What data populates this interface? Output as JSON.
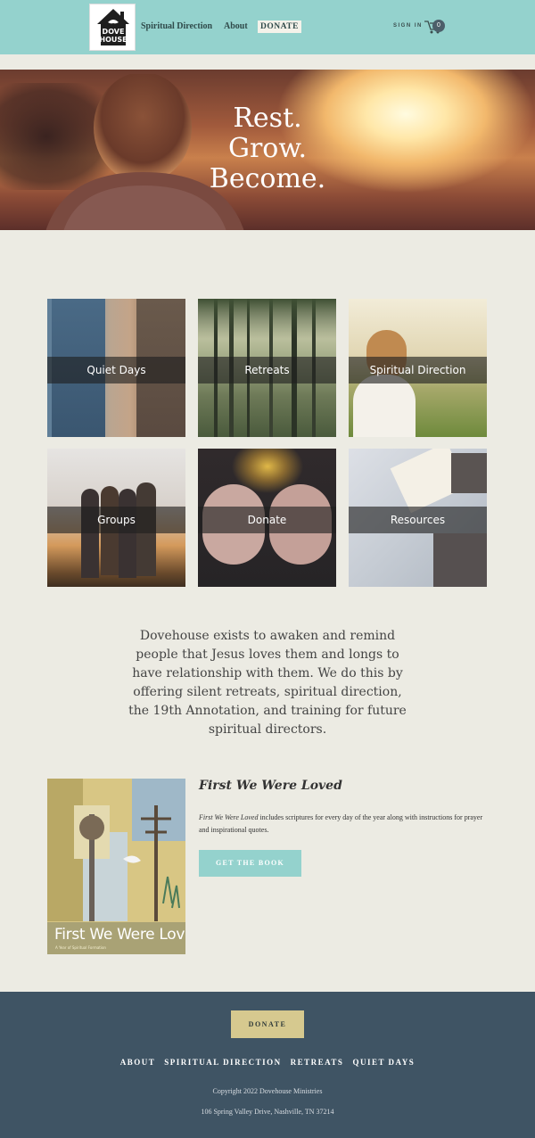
{
  "header": {
    "logo_text": "DOVE HOUSE",
    "nav": {
      "spiritual_direction": "Spiritual Direction",
      "about": "About",
      "donate": "DONATE"
    },
    "sign_in": "SIGN IN",
    "cart_count": "0",
    "brand_color": "#94d2cd"
  },
  "hero": {
    "line1": "Rest.",
    "line2": "Grow.",
    "line3": "Become."
  },
  "tiles": [
    {
      "label": "Quiet Days",
      "icon": "person-leaning-photo"
    },
    {
      "label": "Retreats",
      "icon": "forest-photo"
    },
    {
      "label": "Spiritual Direction",
      "icon": "woman-praying-photo"
    },
    {
      "label": "Groups",
      "icon": "friends-sunset-photo"
    },
    {
      "label": "Donate",
      "icon": "open-hands-photo"
    },
    {
      "label": "Resources",
      "icon": "open-book-photo"
    }
  ],
  "mission": {
    "text": "Dovehouse exists to awaken and remind people that Jesus loves them and longs to have relationship with them. We do this by offering silent retreats, spiritual direction, the 19th Annotation, and training for future spiritual directors."
  },
  "book": {
    "heading": "First We Were Loved",
    "desc_title": "First We Were Loved",
    "desc_rest": " includes scriptures for every day of the year along with instructions for prayer and inspirational quotes.",
    "cover_title": "First We Were Loved",
    "cover_subtitle": "A Year of Spiritual Formation",
    "cta": "GET THE BOOK"
  },
  "footer": {
    "donate": "DONATE",
    "nav": [
      "ABOUT",
      "SPIRITUAL DIRECTION",
      "RETREATS",
      "QUIET DAYS"
    ],
    "copyright": "Copyright 2022 Dovehouse Ministries",
    "address": "106 Spring Valley Drive, Nashville, TN 37214",
    "bg_color": "#3f5464"
  }
}
